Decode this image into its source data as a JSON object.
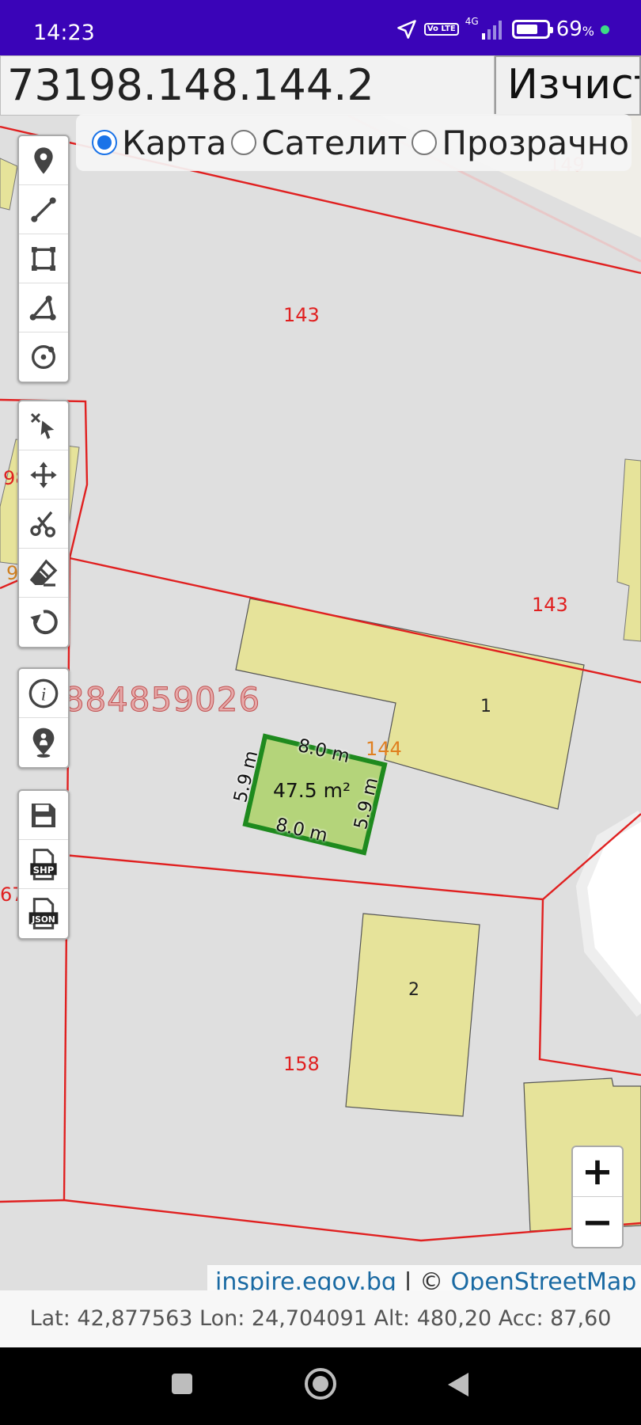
{
  "status_bar": {
    "time": "14:23",
    "volte": "Vo LTE",
    "network": "4G",
    "battery": "69",
    "battery_unit": "%",
    "icons": [
      "location-arrow-icon",
      "volte-icon",
      "signal-icon",
      "battery-icon",
      "green-dot-icon"
    ]
  },
  "search": {
    "value": "73198.148.144.2",
    "clear_label": "Изчист"
  },
  "layers": {
    "options": [
      {
        "label": "Карта",
        "selected": true
      },
      {
        "label": "Сателит",
        "selected": false
      },
      {
        "label": "Прозрачно",
        "selected": false
      }
    ]
  },
  "toolbars": {
    "draw": [
      "marker-icon",
      "line-icon",
      "rectangle-icon",
      "polygon-icon",
      "circle-icon"
    ],
    "edit": [
      "select-icon",
      "move-icon",
      "cut-icon",
      "eraser-icon",
      "undo-icon"
    ],
    "info": [
      "info-icon",
      "person-location-icon"
    ],
    "export": [
      "save-icon",
      "shp-icon",
      "json-icon"
    ],
    "shp_label": "SHP",
    "json_label": "JSON"
  },
  "map": {
    "parcel_labels": {
      "p149": "149",
      "p143a": "143",
      "p143b": "143",
      "p98": "98",
      "p9": "9",
      "p144": "144",
      "p67": "67",
      "p158": "158"
    },
    "building_labels": {
      "b1": "1",
      "b2": "2"
    },
    "watermark": "0884859026",
    "measurement": {
      "area": "47.5 m²",
      "top": "8.0 m",
      "bottom": "8.0 m",
      "left": "5.9 m",
      "right": "5.9 m"
    },
    "colors": {
      "parcel_line": "#e02020",
      "building_fill": "#e6e39a",
      "measure_fill": "#b4d47a",
      "measure_stroke": "#1e8a1e"
    }
  },
  "zoom": {
    "in": "+",
    "out": "−"
  },
  "attribution": {
    "source": "inspire.egov.bg",
    "separator": " | © ",
    "osm": "OpenStreetMap"
  },
  "coordinates": "Lat: 42,877563 Lon: 24,704091 Alt: 480,20 Acc: 87,60"
}
